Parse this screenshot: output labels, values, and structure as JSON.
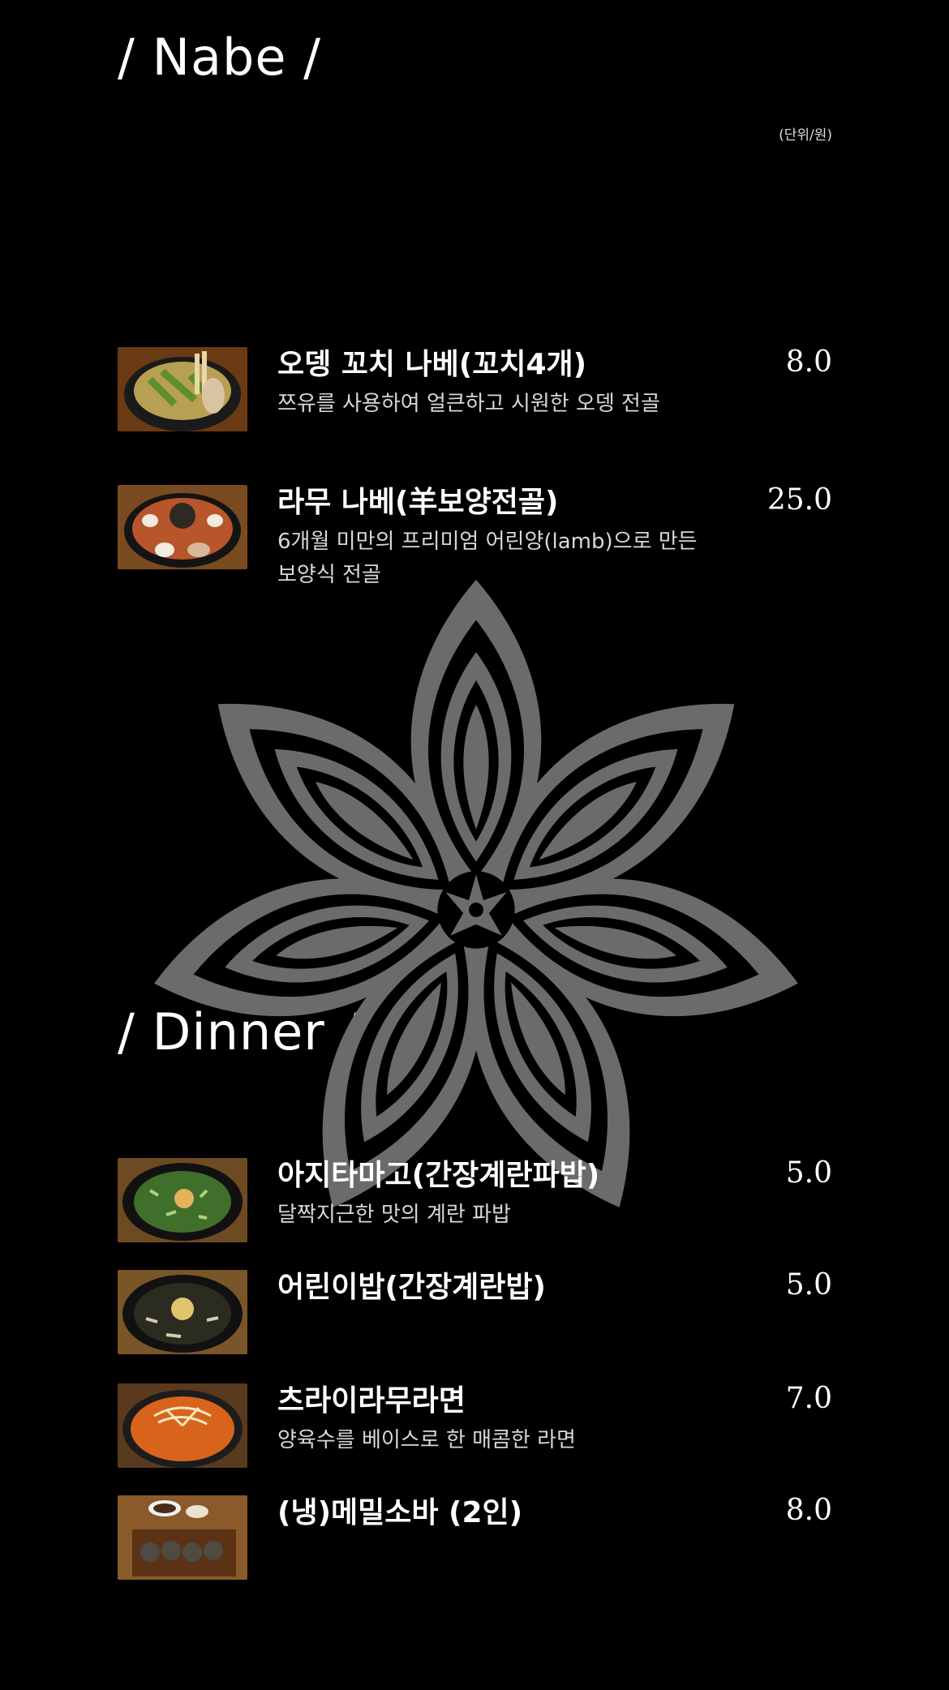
{
  "nabe": {
    "title": "/ Nabe /",
    "unit_note": "(단위/원)",
    "items": [
      {
        "name": "오뎅 꼬치 나베(꼬치4개)",
        "description": "쯔유를 사용하여 얼큰하고 시원한 오뎅 전골",
        "price": "8.0",
        "image": "oden-hotpot-photo"
      },
      {
        "name": "라무 나베(羊보양전골)",
        "description": "6개월 미만의 프리미엄 어린양(lamb)으로 만든 보양식 전골",
        "price": "25.0",
        "image": "lamb-hotpot-photo"
      }
    ]
  },
  "dinner": {
    "title": "/ Dinner /",
    "items": [
      {
        "name": "아지타마고(간장계란파밥)",
        "description": "달짝지근한 맛의 계란 파밥",
        "price": "5.0",
        "image": "egg-scallion-rice-photo"
      },
      {
        "name": "어린이밥(간장계란밥)",
        "description": "",
        "price": "5.0",
        "image": "kids-egg-rice-photo"
      },
      {
        "name": "츠라이라무라면",
        "description": "양육수를 베이스로 한 매콤한 라면",
        "price": "7.0",
        "image": "spicy-lamb-ramen-photo"
      },
      {
        "name": "(냉)메밀소바 (2인)",
        "description": "",
        "price": "8.0",
        "image": "cold-soba-photo"
      }
    ]
  },
  "colors": {
    "background": "#000000",
    "text": "#ffffff",
    "ornament": "#6b6b6b"
  },
  "decoration": "flower-ornament"
}
